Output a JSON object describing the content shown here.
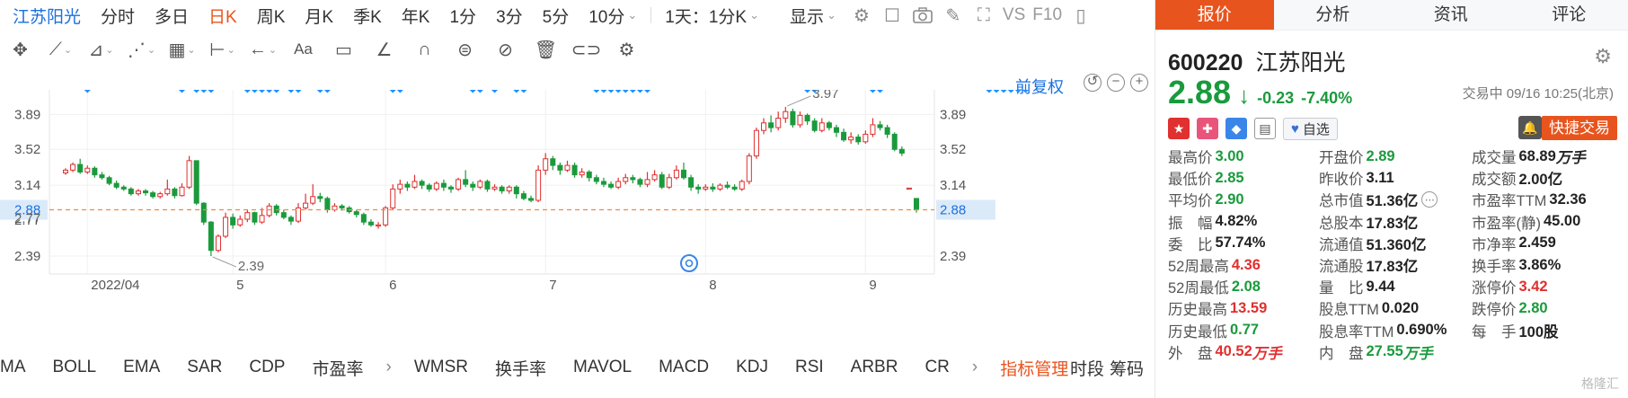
{
  "toolbar": {
    "stock_name": "江苏阳光",
    "periods": [
      "分时",
      "多日",
      "日K",
      "周K",
      "月K",
      "季K",
      "年K",
      "1分",
      "3分",
      "5分"
    ],
    "active_period": "日K",
    "period_select": "10分",
    "interval_select": "1天：1分K",
    "display_label": "显示",
    "vs_label": "VS",
    "f10_label": "F10"
  },
  "chart": {
    "fuquan_label": "前复权",
    "y_ticks_left": [
      "3.89",
      "3.52",
      "3.14",
      "2.88",
      "2.77",
      "2.39"
    ],
    "y_ticks_right": [
      "3.89",
      "3.52",
      "3.14",
      "2.88",
      "2.39"
    ],
    "x_ticks": [
      "2022/04",
      "5",
      "6",
      "7",
      "8",
      "9"
    ],
    "current_price_label": "2.88",
    "high_label": "3.97",
    "low_label": "2.39",
    "accent_red": "#e03030",
    "accent_green": "#1a9a3c",
    "marker_color": "#1e90ff"
  },
  "chart_data": {
    "type": "candlestick",
    "ylim": [
      2.2,
      4.15
    ],
    "grid": true,
    "x_ticks": [
      "2022/04",
      "5",
      "6",
      "7",
      "8",
      "9"
    ],
    "candles": [
      [
        3.27,
        3.3,
        3.25,
        3.32
      ],
      [
        3.3,
        3.36,
        3.28,
        3.38
      ],
      [
        3.36,
        3.28,
        3.26,
        3.42
      ],
      [
        3.28,
        3.32,
        3.26,
        3.35
      ],
      [
        3.32,
        3.25,
        3.22,
        3.34
      ],
      [
        3.25,
        3.22,
        3.2,
        3.28
      ],
      [
        3.22,
        3.16,
        3.14,
        3.24
      ],
      [
        3.16,
        3.12,
        3.1,
        3.19
      ],
      [
        3.12,
        3.1,
        3.08,
        3.14
      ],
      [
        3.1,
        3.05,
        3.03,
        3.12
      ],
      [
        3.05,
        3.08,
        3.03,
        3.1
      ],
      [
        3.08,
        3.06,
        3.03,
        3.1
      ],
      [
        3.06,
        3.02,
        3.0,
        3.08
      ],
      [
        3.02,
        3.05,
        3.0,
        3.07
      ],
      [
        3.05,
        3.1,
        3.03,
        3.2
      ],
      [
        3.1,
        3.03,
        3.0,
        3.12
      ],
      [
        3.03,
        3.12,
        3.02,
        3.16
      ],
      [
        3.12,
        3.4,
        3.1,
        3.45
      ],
      [
        3.4,
        2.95,
        2.93,
        3.4
      ],
      [
        2.95,
        2.75,
        2.72,
        2.96
      ],
      [
        2.75,
        2.45,
        2.39,
        2.76
      ],
      [
        2.45,
        2.6,
        2.43,
        2.62
      ],
      [
        2.6,
        2.8,
        2.58,
        2.85
      ],
      [
        2.8,
        2.72,
        2.68,
        2.84
      ],
      [
        2.72,
        2.78,
        2.7,
        2.82
      ],
      [
        2.78,
        2.85,
        2.75,
        2.88
      ],
      [
        2.85,
        2.75,
        2.72,
        2.86
      ],
      [
        2.75,
        2.82,
        2.73,
        2.9
      ],
      [
        2.82,
        2.92,
        2.8,
        2.95
      ],
      [
        2.92,
        2.85,
        2.82,
        2.94
      ],
      [
        2.85,
        2.8,
        2.78,
        2.88
      ],
      [
        2.8,
        2.76,
        2.72,
        2.82
      ],
      [
        2.76,
        2.9,
        2.74,
        2.95
      ],
      [
        2.9,
        2.95,
        2.88,
        3.05
      ],
      [
        2.95,
        3.02,
        2.93,
        3.15
      ],
      [
        3.02,
        3.0,
        2.96,
        3.06
      ],
      [
        3.0,
        2.88,
        2.85,
        3.02
      ],
      [
        2.88,
        2.92,
        2.86,
        2.95
      ],
      [
        2.92,
        2.9,
        2.87,
        2.94
      ],
      [
        2.9,
        2.86,
        2.84,
        2.92
      ],
      [
        2.86,
        2.83,
        2.8,
        2.88
      ],
      [
        2.83,
        2.75,
        2.72,
        2.85
      ],
      [
        2.75,
        2.72,
        2.7,
        2.78
      ],
      [
        2.72,
        2.72,
        2.68,
        2.75
      ],
      [
        2.72,
        2.9,
        2.7,
        2.92
      ],
      [
        2.9,
        3.1,
        2.88,
        3.15
      ],
      [
        3.1,
        3.15,
        3.05,
        3.2
      ],
      [
        3.15,
        3.12,
        3.08,
        3.18
      ],
      [
        3.12,
        3.18,
        3.1,
        3.25
      ],
      [
        3.18,
        3.14,
        3.1,
        3.2
      ],
      [
        3.14,
        3.1,
        3.07,
        3.16
      ],
      [
        3.1,
        3.16,
        3.08,
        3.18
      ],
      [
        3.16,
        3.12,
        3.08,
        3.2
      ],
      [
        3.12,
        3.1,
        3.06,
        3.14
      ],
      [
        3.1,
        3.2,
        3.08,
        3.22
      ],
      [
        3.2,
        3.15,
        3.12,
        3.3
      ],
      [
        3.15,
        3.12,
        3.08,
        3.18
      ],
      [
        3.12,
        3.18,
        3.1,
        3.2
      ],
      [
        3.18,
        3.1,
        3.07,
        3.2
      ],
      [
        3.1,
        3.12,
        3.08,
        3.15
      ],
      [
        3.12,
        3.08,
        3.05,
        3.14
      ],
      [
        3.08,
        3.12,
        3.05,
        3.14
      ],
      [
        3.12,
        3.05,
        3.0,
        3.14
      ],
      [
        3.05,
        3.0,
        2.98,
        3.08
      ],
      [
        3.0,
        2.98,
        2.96,
        3.03
      ],
      [
        2.98,
        3.3,
        2.96,
        3.35
      ],
      [
        3.3,
        3.42,
        3.25,
        3.48
      ],
      [
        3.42,
        3.35,
        3.3,
        3.45
      ],
      [
        3.35,
        3.3,
        3.25,
        3.38
      ],
      [
        3.3,
        3.35,
        3.28,
        3.4
      ],
      [
        3.35,
        3.25,
        3.22,
        3.38
      ],
      [
        3.25,
        3.28,
        3.22,
        3.32
      ],
      [
        3.28,
        3.22,
        3.18,
        3.3
      ],
      [
        3.22,
        3.18,
        3.15,
        3.25
      ],
      [
        3.18,
        3.15,
        3.12,
        3.22
      ],
      [
        3.15,
        3.12,
        3.1,
        3.18
      ],
      [
        3.12,
        3.18,
        3.1,
        3.22
      ],
      [
        3.18,
        3.22,
        3.15,
        3.26
      ],
      [
        3.22,
        3.2,
        3.16,
        3.25
      ],
      [
        3.2,
        3.15,
        3.12,
        3.22
      ],
      [
        3.15,
        3.2,
        3.12,
        3.28
      ],
      [
        3.2,
        3.25,
        3.18,
        3.3
      ],
      [
        3.25,
        3.12,
        3.1,
        3.28
      ],
      [
        3.12,
        3.22,
        3.1,
        3.26
      ],
      [
        3.22,
        3.3,
        3.2,
        3.35
      ],
      [
        3.3,
        3.22,
        3.2,
        3.38
      ],
      [
        3.22,
        3.12,
        3.08,
        3.25
      ],
      [
        3.12,
        3.1,
        3.05,
        3.15
      ],
      [
        3.1,
        3.12,
        3.08,
        3.15
      ],
      [
        3.12,
        3.1,
        3.07,
        3.16
      ],
      [
        3.1,
        3.14,
        3.08,
        3.16
      ],
      [
        3.14,
        3.12,
        3.1,
        3.18
      ],
      [
        3.12,
        3.1,
        3.08,
        3.15
      ],
      [
        3.1,
        3.18,
        3.08,
        3.2
      ],
      [
        3.18,
        3.45,
        3.15,
        3.48
      ],
      [
        3.45,
        3.72,
        3.42,
        3.75
      ],
      [
        3.72,
        3.8,
        3.68,
        3.85
      ],
      [
        3.8,
        3.75,
        3.7,
        3.88
      ],
      [
        3.75,
        3.85,
        3.72,
        3.92
      ],
      [
        3.85,
        3.92,
        3.8,
        3.97
      ],
      [
        3.92,
        3.78,
        3.75,
        3.95
      ],
      [
        3.78,
        3.88,
        3.75,
        3.92
      ],
      [
        3.88,
        3.82,
        3.78,
        3.9
      ],
      [
        3.82,
        3.72,
        3.7,
        3.85
      ],
      [
        3.72,
        3.8,
        3.7,
        3.85
      ],
      [
        3.8,
        3.75,
        3.72,
        3.82
      ],
      [
        3.75,
        3.7,
        3.65,
        3.78
      ],
      [
        3.7,
        3.62,
        3.6,
        3.74
      ],
      [
        3.62,
        3.65,
        3.58,
        3.7
      ],
      [
        3.65,
        3.6,
        3.57,
        3.68
      ],
      [
        3.6,
        3.68,
        3.58,
        3.72
      ],
      [
        3.68,
        3.78,
        3.65,
        3.85
      ],
      [
        3.78,
        3.75,
        3.72,
        3.82
      ],
      [
        3.75,
        3.68,
        3.64,
        3.78
      ],
      [
        3.68,
        3.52,
        3.5,
        3.7
      ],
      [
        3.52,
        3.48,
        3.45,
        3.55
      ],
      [
        3.11,
        3.11,
        3.11,
        3.11
      ],
      [
        3.0,
        2.88,
        2.85,
        3.0
      ]
    ],
    "current_price": 2.88,
    "markers": [
      3,
      16,
      18,
      19,
      20,
      25,
      26,
      27,
      28,
      29,
      31,
      32,
      35,
      36,
      45,
      46,
      56,
      57,
      59,
      62,
      63,
      73,
      74,
      75,
      76,
      77,
      78,
      79,
      80,
      102,
      103,
      111,
      112,
      127,
      128,
      129,
      130,
      131,
      132
    ]
  },
  "indicators": {
    "items": [
      "MA",
      "BOLL",
      "EMA",
      "SAR",
      "CDP",
      "市盈率"
    ],
    "items2": [
      "WMSR",
      "换手率",
      "MAVOL",
      "MACD",
      "KDJ",
      "RSI",
      "ARBR",
      "CR"
    ],
    "management": "指标管理",
    "right": [
      "时段",
      "筹码"
    ]
  },
  "panel": {
    "tabs": [
      "报价",
      "分析",
      "资讯",
      "评论"
    ],
    "active_tab": "报价",
    "code": "600220",
    "name": "江苏阳光",
    "price": "2.88",
    "change": "-0.23",
    "change_pct": "-7.40%",
    "status": "交易中 09/16 10:25(北京)",
    "zixuan_label": "自选",
    "quick_trade": "快捷交易"
  },
  "stats": [
    {
      "label": "最高价",
      "value": "3.00",
      "cls": "down"
    },
    {
      "label": "开盘价",
      "value": "2.89",
      "cls": "down"
    },
    {
      "label": "成交量",
      "value": "68.89",
      "unit": "万手",
      "cls": ""
    },
    {
      "label": "最低价",
      "value": "2.85",
      "cls": "down"
    },
    {
      "label": "昨收价",
      "value": "3.11",
      "cls": ""
    },
    {
      "label": "成交额",
      "value": "2.00亿",
      "cls": ""
    },
    {
      "label": "平均价",
      "value": "2.90",
      "cls": "down"
    },
    {
      "label": "总市值",
      "value": "51.36亿",
      "cls": "",
      "more": true
    },
    {
      "label": "市盈率TTM",
      "value": "32.36",
      "cls": ""
    },
    {
      "label": "振　幅",
      "value": "4.82%",
      "cls": ""
    },
    {
      "label": "总股本",
      "value": "17.83亿",
      "cls": ""
    },
    {
      "label": "市盈率(静)",
      "value": "45.00",
      "cls": ""
    },
    {
      "label": "委　比",
      "value": "57.74%",
      "cls": ""
    },
    {
      "label": "流通值",
      "value": "51.360亿",
      "cls": ""
    },
    {
      "label": "市净率",
      "value": "2.459",
      "cls": ""
    },
    {
      "label": "52周最高",
      "value": "4.36",
      "cls": "up"
    },
    {
      "label": "流通股",
      "value": "17.83亿",
      "cls": ""
    },
    {
      "label": "换手率",
      "value": "3.86%",
      "cls": ""
    },
    {
      "label": "52周最低",
      "value": "2.08",
      "cls": "down"
    },
    {
      "label": "量　比",
      "value": "9.44",
      "cls": ""
    },
    {
      "label": "涨停价",
      "value": "3.42",
      "cls": "up"
    },
    {
      "label": "历史最高",
      "value": "13.59",
      "cls": "up"
    },
    {
      "label": "股息TTM",
      "value": "0.020",
      "cls": ""
    },
    {
      "label": "跌停价",
      "value": "2.80",
      "cls": "down"
    },
    {
      "label": "历史最低",
      "value": "0.77",
      "cls": "down"
    },
    {
      "label": "股息率TTM",
      "value": "0.690%",
      "cls": ""
    },
    {
      "label": "每　手",
      "value": "100股",
      "cls": ""
    },
    {
      "label": "外　盘",
      "value": "40.52",
      "unit": "万手",
      "cls": "up"
    },
    {
      "label": "内　盘",
      "value": "27.55",
      "unit": "万手",
      "cls": "down"
    }
  ],
  "watermark": "格隆汇"
}
